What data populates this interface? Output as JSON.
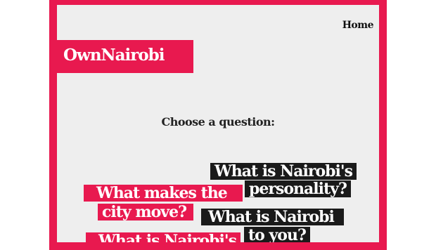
{
  "nav": {
    "home_label": "Home"
  },
  "brand": {
    "logo_text": "OwnNairobi"
  },
  "main": {
    "prompt": "Choose a question:",
    "questions": [
      {
        "lines": [
          "What is Nairobi's",
          "personality?"
        ],
        "style": "black"
      },
      {
        "lines": [
          "What makes the",
          "city move?"
        ],
        "style": "pink"
      },
      {
        "lines": [
          "What is Nairobi",
          "to you?"
        ],
        "style": "black"
      },
      {
        "lines": [
          "What is Nairobi's"
        ],
        "style": "pink"
      }
    ]
  },
  "colors": {
    "accent": "#e8194f",
    "dark": "#1a1a1a",
    "panel": "#eeeeee"
  }
}
